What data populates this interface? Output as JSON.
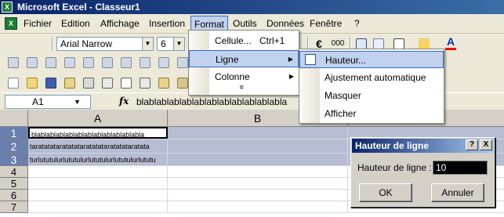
{
  "window": {
    "title": "Microsoft Excel - Classeur1",
    "app_icon_text": "X"
  },
  "menubar": {
    "items": [
      {
        "label": "Fichier"
      },
      {
        "label": "Edition"
      },
      {
        "label": "Affichage"
      },
      {
        "label": "Insertion"
      },
      {
        "label": "Format"
      },
      {
        "label": "Outils"
      },
      {
        "label": "Données"
      },
      {
        "label": "Fenêtre"
      },
      {
        "label": "?"
      }
    ]
  },
  "toolbar": {
    "font_name": "Arial Narrow",
    "font_size": "6",
    "currency_symbol": "€",
    "thousands_label": "000"
  },
  "formula_bar": {
    "name_box": "A1",
    "fx_label": "fx",
    "value": "blablablablablablablablablablablabla"
  },
  "grid": {
    "columns": [
      "A",
      "B"
    ],
    "rows": [
      {
        "num": "1",
        "a": "blablablablablablablablablablablabla"
      },
      {
        "num": "2",
        "a": "taratatataratatataratatataratatataratata"
      },
      {
        "num": "3",
        "a": "turlututulurlututulurlututulurlututulurlututu"
      },
      {
        "num": "4",
        "a": ""
      },
      {
        "num": "5",
        "a": ""
      },
      {
        "num": "6",
        "a": ""
      },
      {
        "num": "7",
        "a": ""
      }
    ]
  },
  "format_menu": {
    "items": [
      {
        "label": "Cellule...",
        "shortcut": "Ctrl+1",
        "submenu": false
      },
      {
        "label": "Ligne",
        "shortcut": "",
        "submenu": true
      },
      {
        "label": "Colonne",
        "shortcut": "",
        "submenu": true
      }
    ],
    "more_label": "»"
  },
  "ligne_menu": {
    "items": [
      {
        "label": "Hauteur..."
      },
      {
        "label": "Ajustement automatique"
      },
      {
        "label": "Masquer"
      },
      {
        "label": "Afficher"
      }
    ]
  },
  "dialog": {
    "title": "Hauteur de ligne",
    "help_label": "?",
    "close_label": "X",
    "field_label": "Hauteur de ligne :",
    "field_value": "10",
    "ok_label": "OK",
    "cancel_label": "Annuler"
  },
  "colors": {
    "title_bar": "#0a246a",
    "menu_highlight": "#c1d2ee",
    "menu_highlight_border": "#316ac5",
    "selected_row_header": "#6a7fae",
    "selected_row_fill": "#b6bdd2"
  }
}
